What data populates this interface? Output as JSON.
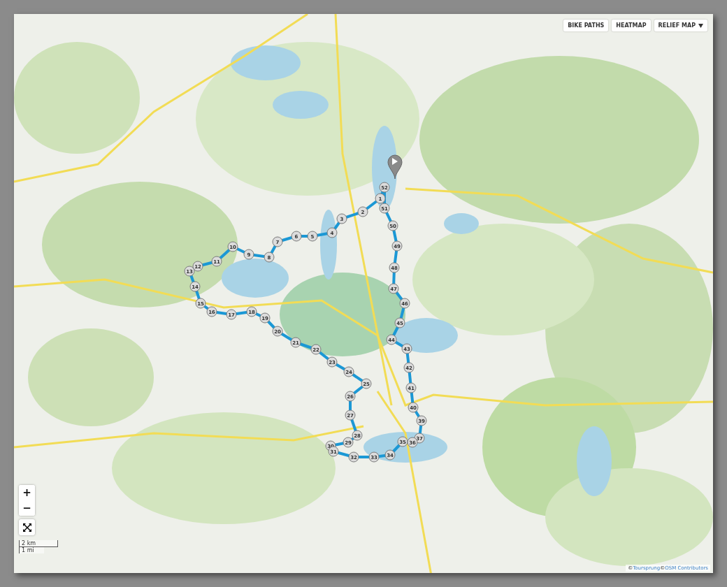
{
  "map_buttons": [
    {
      "label": "BIKE PATHS",
      "kind": "plain"
    },
    {
      "label": "HEATMAP",
      "kind": "plain"
    },
    {
      "label": "RELIEF MAP",
      "kind": "dropdown"
    }
  ],
  "zoom": {
    "in": "+",
    "out": "−"
  },
  "scale": {
    "metric": "2 km",
    "imperial": "1 mi"
  },
  "route": {
    "waypoints": [
      "52",
      "1",
      "51",
      "2",
      "3",
      "50",
      "4",
      "5",
      "6",
      "7",
      "49",
      "10",
      "9",
      "8",
      "11",
      "12",
      "48",
      "13",
      "14",
      "47",
      "15",
      "46",
      "16",
      "18",
      "17",
      "19",
      "45",
      "20",
      "44",
      "21",
      "43",
      "22",
      "23",
      "42",
      "24",
      "25",
      "41",
      "26",
      "40",
      "27",
      "39",
      "28",
      "37",
      "29",
      "35",
      "36",
      "30",
      "31",
      "34",
      "32",
      "33"
    ]
  },
  "attribution": [
    {
      "symbol": "©",
      "link": "Toursprung"
    },
    {
      "symbol": "©",
      "link": "OSM Contributors"
    }
  ]
}
